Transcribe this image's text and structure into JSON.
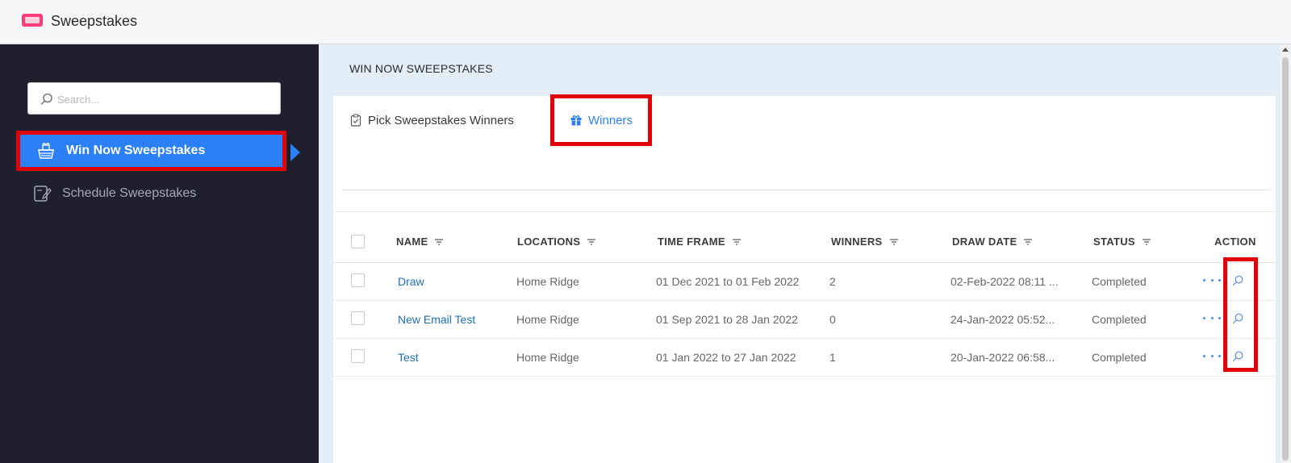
{
  "app": {
    "title": "Sweepstakes",
    "logo_icon": "ticket-icon",
    "accent_color": "#ff3e7a"
  },
  "sidebar": {
    "search_placeholder": "Search...",
    "items": [
      {
        "label": "Win Now Sweepstakes",
        "icon": "gift-basket-icon",
        "active": true
      },
      {
        "label": "Schedule Sweepstakes",
        "icon": "schedule-edit-icon",
        "active": false
      }
    ],
    "active_color": "#2b7ff7",
    "background": "#1f1f2e"
  },
  "main": {
    "section_title": "WIN NOW SWEEPSTAKES",
    "tabs": [
      {
        "label": "Pick Sweepstakes Winners",
        "icon": "clipboard-check-icon",
        "active": false
      },
      {
        "label": "Winners",
        "icon": "gift-icon",
        "active": true
      }
    ]
  },
  "table": {
    "columns": [
      "NAME",
      "LOCATIONS",
      "TIME FRAME",
      "WINNERS",
      "DRAW DATE",
      "STATUS",
      "ACTION"
    ],
    "rows": [
      {
        "name": "Draw",
        "location": "Home Ridge",
        "time_frame": "01 Dec 2021 to 01 Feb 2022",
        "winners": "2",
        "draw_date": "02-Feb-2022 08:11 ...",
        "status": "Completed"
      },
      {
        "name": "New Email Test",
        "location": "Home Ridge",
        "time_frame": "01 Sep 2021 to 28 Jan 2022",
        "winners": "0",
        "draw_date": "24-Jan-2022 05:52...",
        "status": "Completed"
      },
      {
        "name": "Test",
        "location": "Home Ridge",
        "time_frame": "01 Jan 2022 to 27 Jan 2022",
        "winners": "1",
        "draw_date": "20-Jan-2022 06:58...",
        "status": "Completed"
      }
    ]
  },
  "highlight_color": "#e0000a"
}
